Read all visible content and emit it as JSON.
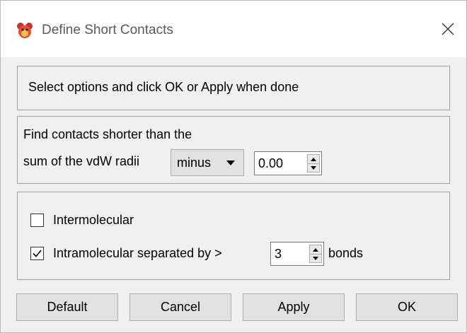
{
  "window": {
    "title": "Define Short Contacts",
    "icon": "app-mascot-icon"
  },
  "instructions": "Select options and click OK or Apply when done",
  "find": {
    "line1": "Find contacts shorter than the",
    "line2_label": "sum of the vdW radii",
    "operator": {
      "selected": "minus"
    },
    "offset": "0.00"
  },
  "options": {
    "intermolecular": {
      "label": "Intermolecular",
      "checked": false
    },
    "intramolecular": {
      "label": "Intramolecular separated by >",
      "checked": true,
      "value": "3",
      "suffix": "bonds"
    }
  },
  "buttons": {
    "default": "Default",
    "cancel": "Cancel",
    "apply": "Apply",
    "ok": "OK"
  },
  "colors": {
    "check": "#000000",
    "title_text": "#5a5a5a"
  }
}
